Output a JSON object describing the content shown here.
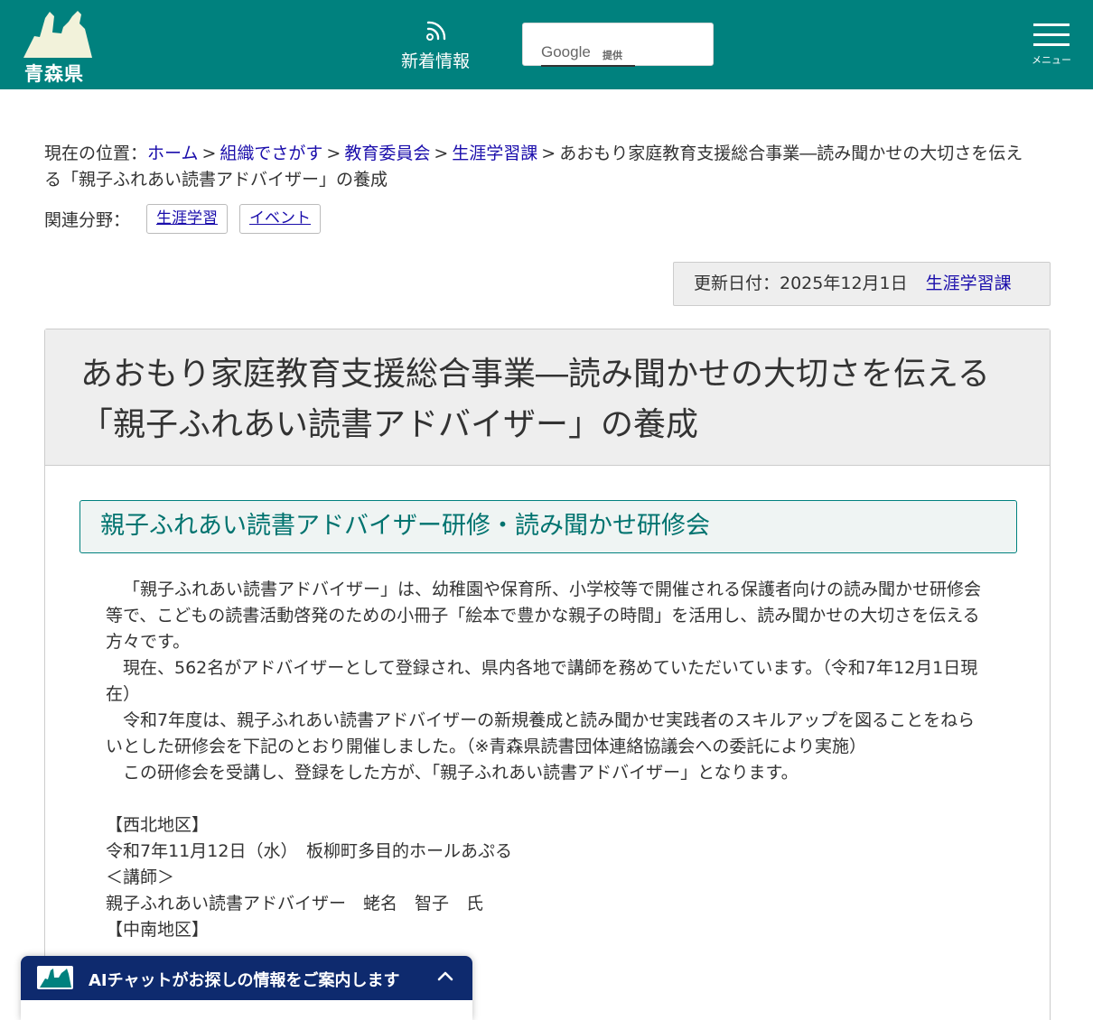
{
  "header": {
    "logo_text": "青森県",
    "news_label": "新着情報",
    "search_brand": "Google",
    "search_provided": "提供",
    "menu_label": "メニュー"
  },
  "breadcrumb": {
    "prefix": "現在の位置：",
    "links": [
      "ホーム",
      "組織でさがす",
      "教育委員会",
      "生涯学習課"
    ],
    "separator": ">",
    "current": "あおもり家庭教育支援総合事業―読み聞かせの大切さを伝える「親子ふれあい読書アドバイザー」の養成"
  },
  "related": {
    "label": "関連分野：",
    "tags": [
      "生涯学習",
      "イベント"
    ]
  },
  "update": {
    "date_text": "更新日付：2025年12月1日",
    "department": "生涯学習課"
  },
  "article": {
    "title": "あおもり家庭教育支援総合事業―読み聞かせの大切さを伝える「親子ふれあい読書アドバイザー」の養成",
    "section_heading": "親子ふれあい読書アドバイザー研修・読み聞かせ研修会",
    "paragraphs": [
      "「親子ふれあい読書アドバイザー」は、幼稚園や保育所、小学校等で開催される保護者向けの読み聞かせ研修会等で、こどもの読書活動啓発のための小冊子「絵本で豊かな親子の時間」を活用し、読み聞かせの大切さを伝える方々です。",
      "現在、562名がアドバイザーとして登録され、県内各地で講師を務めていただいています。（令和7年12月1日現在）",
      "令和7年度は、親子ふれあい読書アドバイザーの新規養成と読み聞かせ実践者のスキルアップを図ることをねらいとした研修会を下記のとおり開催しました。（※青森県読書団体連絡協議会への委託により実施）",
      "この研修会を受講し、登録をした方が、「親子ふれあい読書アドバイザー」となります。"
    ],
    "region1_heading": "【西北地区】",
    "region1_date": "令和7年11月12日（水）　板柳町多目的ホールあぷる",
    "region1_lecturer_heading": "＜講師＞",
    "region1_lecturer": "親子ふれあい読書アドバイザー　蛯名　智子　氏",
    "region2_heading": "【中南地区】"
  },
  "chat": {
    "label": "AIチャットがお探しの情報をご案内します"
  },
  "colors": {
    "header_bg": "#00817e",
    "link": "#1a0dab",
    "chat_bg": "#0e2a6e",
    "heading_text": "#00736f"
  }
}
